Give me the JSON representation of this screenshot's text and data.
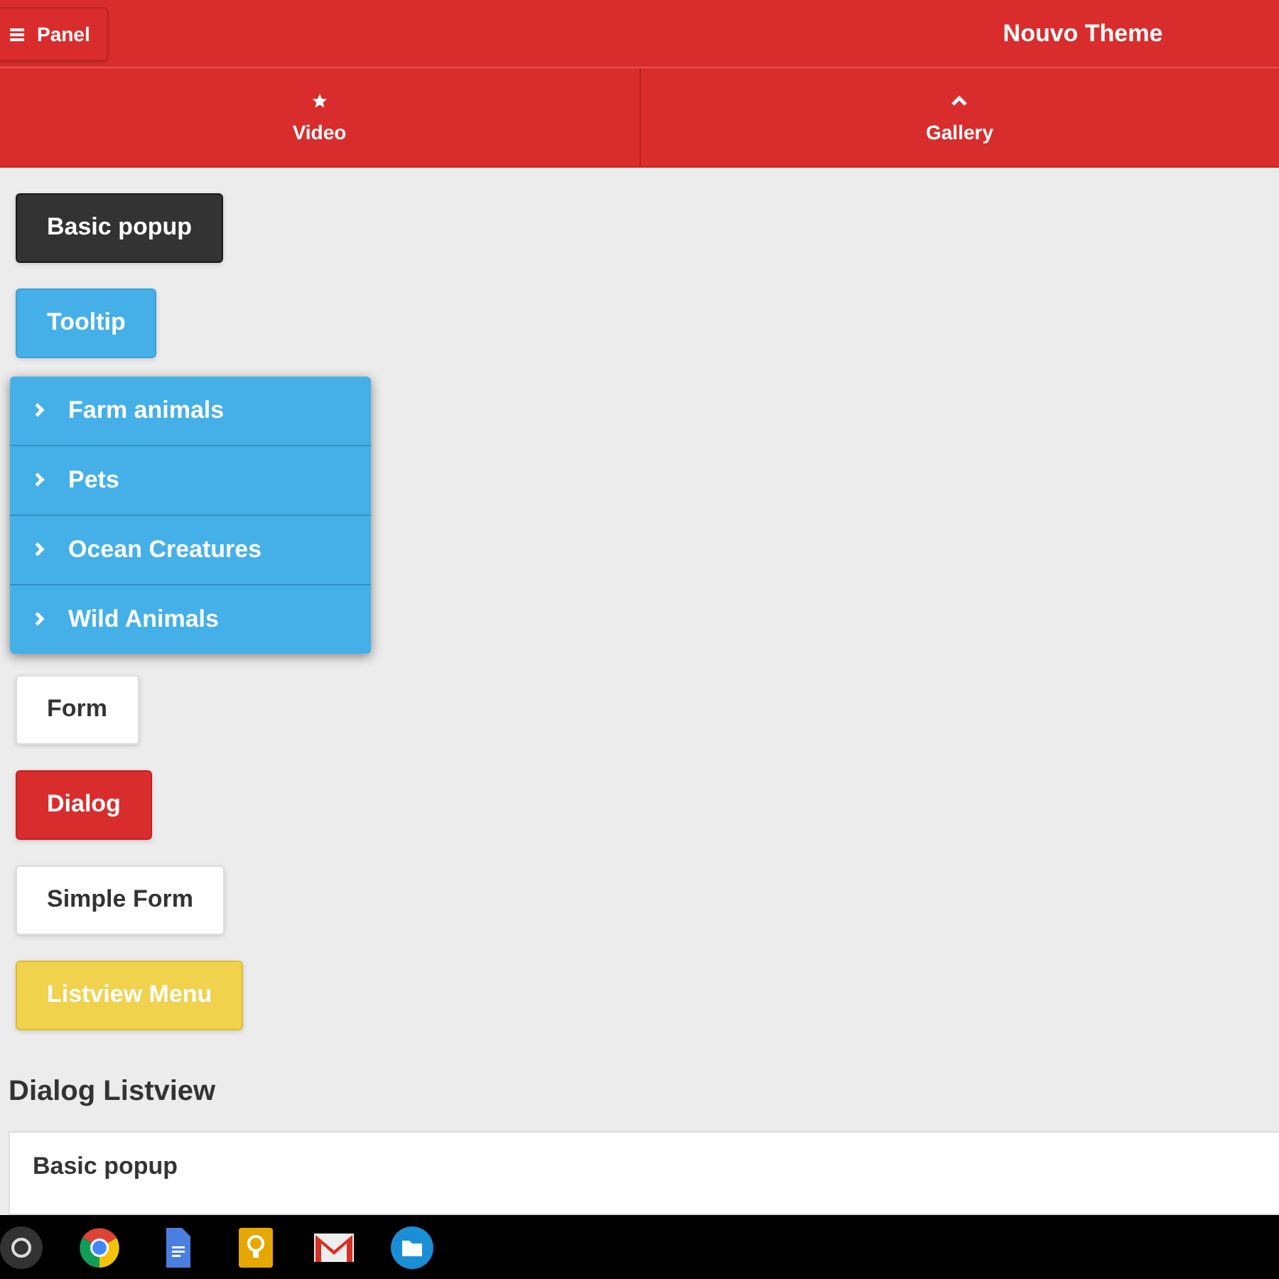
{
  "header": {
    "panel_button": "Panel",
    "title": "Nouvo Theme"
  },
  "navbar": [
    {
      "label": "Video",
      "kind": "star"
    },
    {
      "label": "Gallery",
      "kind": "caret"
    }
  ],
  "buttons_top": [
    {
      "label": "Basic popup",
      "kind": "dark"
    },
    {
      "label": "Tooltip",
      "kind": "blue"
    }
  ],
  "listview": [
    {
      "label": "Farm animals"
    },
    {
      "label": "Pets"
    },
    {
      "label": "Ocean Creatures"
    },
    {
      "label": "Wild Animals"
    }
  ],
  "buttons_bottom": [
    {
      "label": "Form",
      "kind": "white"
    },
    {
      "label": "Dialog",
      "kind": "red"
    },
    {
      "label": "Simple Form",
      "kind": "white"
    },
    {
      "label": "Listview Menu",
      "kind": "yellow"
    }
  ],
  "section": {
    "heading": "Dialog Listview",
    "card_item": "Basic popup"
  },
  "shelf": [
    {
      "kind": "launcher"
    },
    {
      "kind": "browser"
    },
    {
      "kind": "docs"
    },
    {
      "kind": "keep"
    },
    {
      "kind": "mail"
    },
    {
      "kind": "files"
    }
  ]
}
